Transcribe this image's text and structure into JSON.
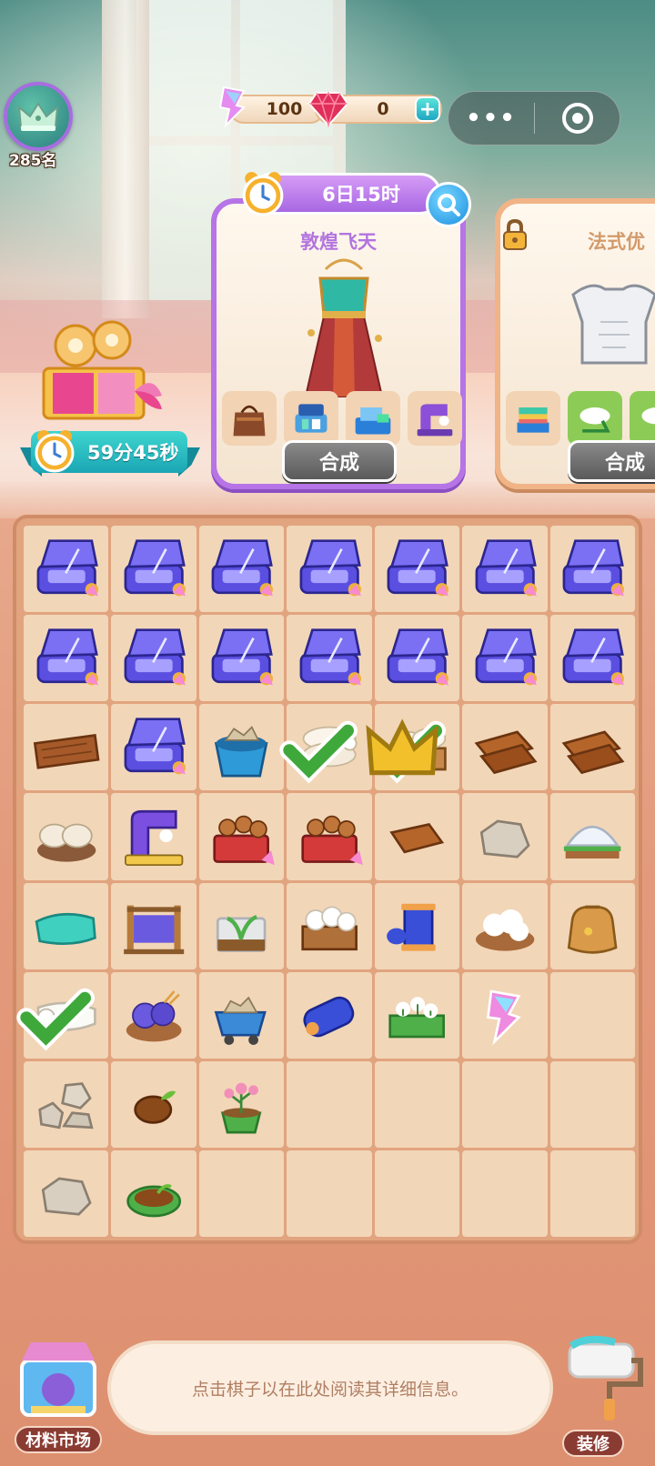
{
  "hud": {
    "rank_label": "285名",
    "energy_value": "100",
    "gem_value": "0",
    "plus_label": "+",
    "more_label": "•••"
  },
  "gift": {
    "timer_label": "59分45秒"
  },
  "orders": [
    {
      "timer_label": "6日15时",
      "title": "敦煌飞天",
      "merge_label": "合成",
      "requirements": [
        "bag-icon",
        "sewing-kit-icon",
        "blue-box-icon",
        "sewing-machine-icon"
      ]
    },
    {
      "title": "法式优",
      "merge_label": "合成",
      "locked": true,
      "requirements": [
        "fabric-stack-icon",
        "fabric-roll-icon",
        "fabric-roll-icon"
      ],
      "completed": [
        1,
        2
      ]
    }
  ],
  "board": {
    "rows": [
      [
        "sewing-kit",
        "sewing-kit",
        "sewing-kit",
        "sewing-kit",
        "sewing-kit",
        "sewing-kit",
        "sewing-kit"
      ],
      [
        "sewing-kit",
        "sewing-kit",
        "sewing-kit",
        "sewing-kit",
        "sewing-kit",
        "sewing-kit",
        "sewing-kit"
      ],
      [
        "wood-planks",
        "sewing-kit",
        "stone-bucket",
        "fabric-roll",
        "fabric-crate",
        "leather-pieces",
        "leather-pieces"
      ],
      [
        "fabric-basket",
        "sewing-machine",
        "wood-chest",
        "wood-chest",
        "leather-piece",
        "stone",
        "cotton-cushion"
      ],
      [
        "teal-cloth",
        "loom",
        "plant-box",
        "cotton-crate",
        "thread-spool",
        "cotton-basket",
        "seed-bag"
      ],
      [
        "white-cloth",
        "yarn-basket",
        "stone-cart",
        "purple-spool",
        "cotton-plant-box",
        "energy-gem",
        ""
      ],
      [
        "stones",
        "seed",
        "flower-pot",
        "",
        "",
        "",
        ""
      ],
      [
        "stone",
        "seed-pot",
        "",
        "",
        "",
        "",
        ""
      ]
    ],
    "checked": [
      [
        2,
        3
      ],
      [
        2,
        4
      ],
      [
        5,
        0
      ]
    ]
  },
  "bottom": {
    "info_text": "点击棋子以在此处阅读其详细信息。",
    "market_label": "材料市场",
    "decor_label": "装修"
  }
}
